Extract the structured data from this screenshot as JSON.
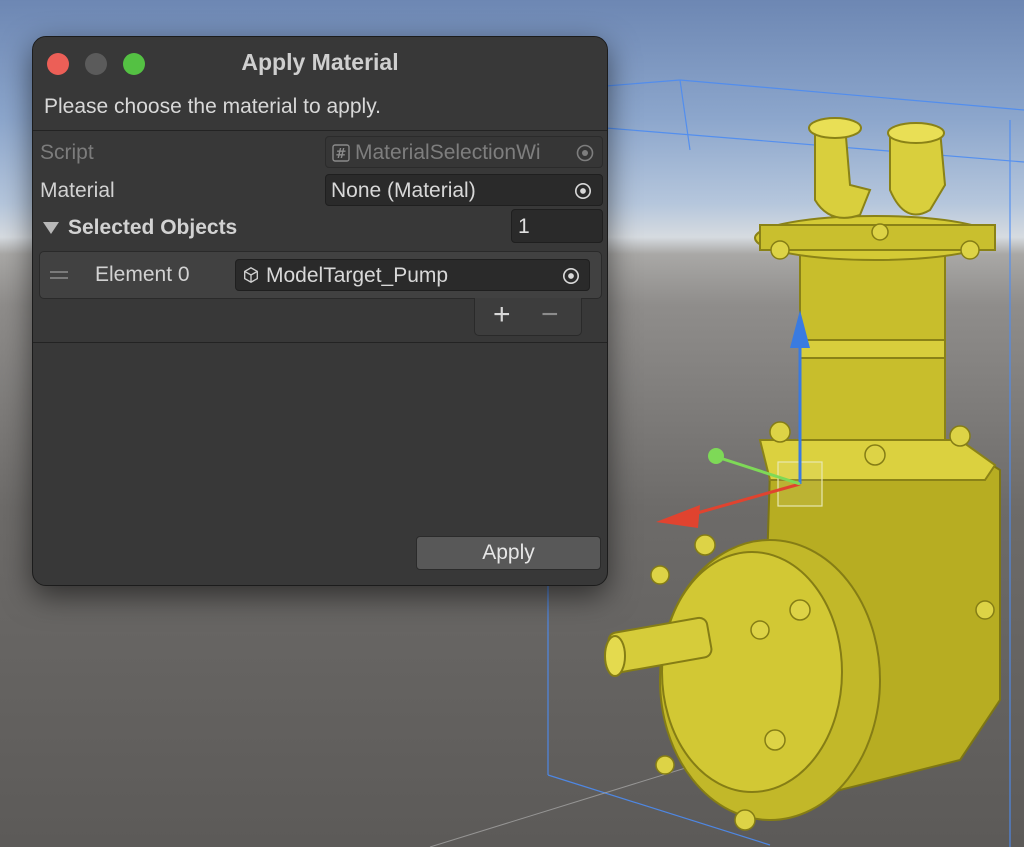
{
  "window": {
    "title": "Apply Material",
    "help_text": "Please choose the material to apply."
  },
  "fields": {
    "script_label": "Script",
    "script_value": "MaterialSelectionWi",
    "material_label": "Material",
    "material_value": "None (Material)",
    "selected_objects_label": "Selected Objects",
    "selected_objects_size": "1"
  },
  "list": {
    "elements": [
      {
        "label": "Element 0",
        "value": "ModelTarget_Pump"
      }
    ],
    "add_label": "+",
    "remove_label": "−"
  },
  "buttons": {
    "apply_label": "Apply"
  },
  "icons": {
    "script": "hash-script-icon",
    "picker": "object-picker-icon",
    "gameobject": "cube-icon"
  },
  "colors": {
    "close": "#ec5f57",
    "minimize": "#5b5b5b",
    "maximize": "#54c143",
    "model": "#d6cc3a",
    "gizmo_y": "#3a7be0",
    "gizmo_x": "#e0432f",
    "gizmo_z": "#7ed957"
  }
}
